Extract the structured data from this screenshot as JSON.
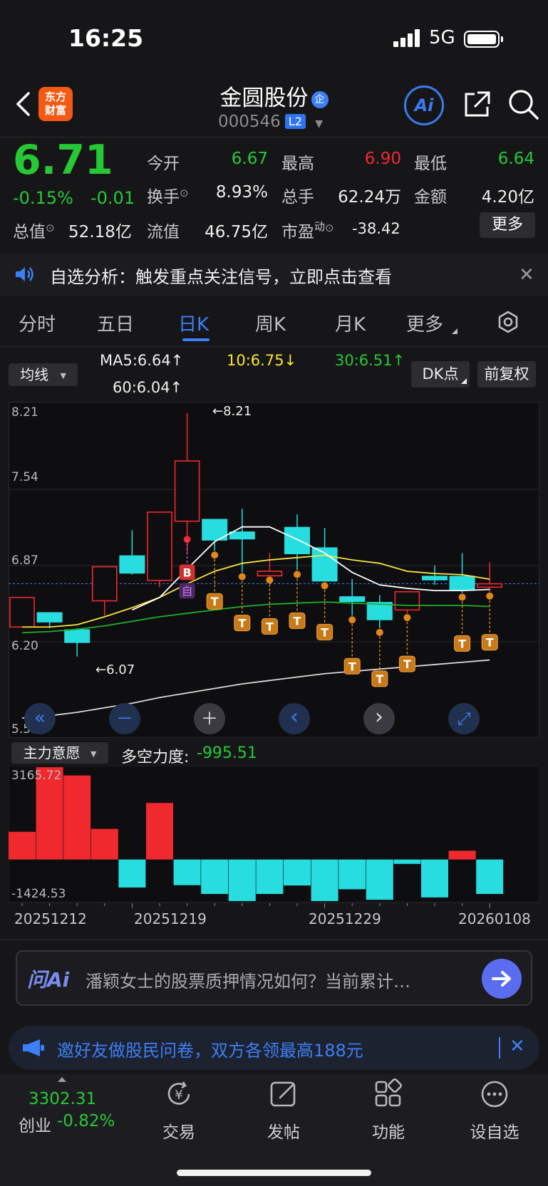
{
  "status_bar": {
    "time": "16:25",
    "network": "5G"
  },
  "header": {
    "logo_text_line1": "东方",
    "logo_text_line2": "财富",
    "stock_name": "金圆股份",
    "enterprise_badge": "企",
    "stock_code": "000546",
    "level_badge": "L2",
    "ai_label": "Ai"
  },
  "quote": {
    "price": "6.71",
    "change_pct": "-0.15%",
    "change": "-0.01",
    "open_label": "今开",
    "open": "6.67",
    "high_label": "最高",
    "high": "6.90",
    "low_label": "最低",
    "low": "6.64",
    "turnover_label": "换手",
    "turnover": "8.93%",
    "volume_label": "总手",
    "volume": "62.24万",
    "amount_label": "金额",
    "amount": "4.20亿",
    "total_value_label": "总值",
    "total_value": "52.18亿",
    "float_value_label": "流值",
    "float_value": "46.75亿",
    "pe_label": "市盈",
    "pe_sup": "动",
    "pe": "-38.42",
    "more_button": "更多"
  },
  "notice": {
    "text": "自选分析：触发重点关注信号，立即点击查看"
  },
  "tabs": [
    {
      "label": "分时"
    },
    {
      "label": "五日"
    },
    {
      "label": "日K"
    },
    {
      "label": "周K"
    },
    {
      "label": "月K"
    },
    {
      "label": "更多"
    }
  ],
  "indicator_bar": {
    "selector_label": "均线",
    "ma5": "MA5:6.64↑",
    "ma10": "10:6.75↓",
    "ma30": "30:6.51↑",
    "ma60": "60:6.04↑",
    "dk_button": "DK点",
    "adjust_button": "前复权"
  },
  "kline": {
    "y_labels": [
      "8.21",
      "7.54",
      "6.87",
      "6.20",
      "5.53"
    ],
    "max_marker": "←8.21",
    "min_marker": "←6.07",
    "buy_marker": "B",
    "self_marker": "自",
    "t_marker": "T",
    "candles": [
      {
        "o": 6.33,
        "c": 6.59,
        "h": 6.59,
        "l": 6.33
      },
      {
        "o": 6.46,
        "c": 6.37,
        "h": 6.46,
        "l": 6.32
      },
      {
        "o": 6.31,
        "c": 6.19,
        "h": 6.32,
        "l": 6.07
      },
      {
        "o": 6.56,
        "c": 6.86,
        "h": 6.86,
        "l": 6.43
      },
      {
        "o": 6.96,
        "c": 6.8,
        "h": 7.18,
        "l": 6.79
      },
      {
        "o": 6.74,
        "c": 7.34,
        "h": 7.34,
        "l": 6.68
      },
      {
        "o": 7.26,
        "c": 7.79,
        "h": 8.21,
        "l": 6.99
      },
      {
        "o": 7.28,
        "c": 7.09,
        "h": 7.28,
        "l": 7.0
      },
      {
        "o": 7.17,
        "c": 7.1,
        "h": 7.37,
        "l": 6.81
      },
      {
        "o": 6.78,
        "c": 6.82,
        "h": 6.98,
        "l": 6.78
      },
      {
        "o": 7.21,
        "c": 6.97,
        "h": 7.32,
        "l": 6.83
      },
      {
        "o": 7.03,
        "c": 6.73,
        "h": 7.2,
        "l": 6.73
      },
      {
        "o": 6.6,
        "c": 6.55,
        "h": 6.75,
        "l": 6.43
      },
      {
        "o": 6.55,
        "c": 6.39,
        "h": 6.61,
        "l": 6.32
      },
      {
        "o": 6.48,
        "c": 6.64,
        "h": 6.64,
        "l": 6.45
      },
      {
        "o": 6.78,
        "c": 6.74,
        "h": 6.87,
        "l": 6.7
      },
      {
        "o": 6.78,
        "c": 6.65,
        "h": 6.98,
        "l": 6.63
      },
      {
        "o": 6.68,
        "c": 6.71,
        "h": 6.9,
        "l": 6.64
      }
    ],
    "ma5": [
      null,
      null,
      null,
      null,
      6.48,
      6.59,
      6.84,
      7.08,
      7.21,
      7.21,
      7.1,
      6.98,
      6.81,
      6.7,
      6.67,
      6.65,
      6.65,
      6.66
    ],
    "ma10": [
      6.33,
      6.33,
      6.35,
      6.42,
      6.5,
      6.59,
      6.71,
      6.82,
      6.89,
      6.92,
      6.94,
      6.96,
      6.92,
      6.89,
      6.82,
      6.8,
      6.79,
      6.75
    ],
    "ma30": [
      6.28,
      6.29,
      6.31,
      6.34,
      6.38,
      6.42,
      6.45,
      6.48,
      6.51,
      6.53,
      6.54,
      6.55,
      6.54,
      6.53,
      6.52,
      6.52,
      6.52,
      6.51
    ],
    "ma60": [
      5.53,
      5.55,
      5.58,
      5.62,
      5.66,
      5.71,
      5.75,
      5.79,
      5.83,
      5.86,
      5.89,
      5.92,
      5.94,
      5.96,
      5.98,
      6.0,
      6.02,
      6.04
    ]
  },
  "chart_controls": [
    "«",
    "－",
    "＋",
    "‹",
    "›",
    "⤢"
  ],
  "force_panel": {
    "selector_label": "主力意愿",
    "title": "多空力度:",
    "value": "-995.51",
    "y_max": "3165.72",
    "y_min": "-1424.53",
    "bars": [
      950,
      3165,
      2880,
      1050,
      -960,
      1940,
      -880,
      -1180,
      -1424,
      -1180,
      -890,
      -1424,
      -1020,
      -1380,
      -150,
      -1300,
      300,
      -1180
    ]
  },
  "x_dates": [
    "20251212",
    "20251219",
    "20251229",
    "20260108"
  ],
  "ask": {
    "brand": "问Ai",
    "placeholder": "潘颖女士的股票质押情况如何？当前累计…"
  },
  "promo": {
    "text": "邀好友做股民问卷，双方各领最高188元"
  },
  "bottom_nav": {
    "index_value": "3302.31",
    "index_name": "创业",
    "index_change": "-0.82%",
    "items": [
      {
        "label": "交易"
      },
      {
        "label": "发帖"
      },
      {
        "label": "功能"
      },
      {
        "label": "设自选"
      }
    ]
  },
  "colors": {
    "up": "#f0292f",
    "down": "#27dde0",
    "green": "#27c835",
    "accent": "#3d7ff5",
    "ma5": "#ffffff",
    "ma10": "#f7e33c",
    "ma30": "#1fae2a",
    "ma60": "#d8d8d8"
  }
}
